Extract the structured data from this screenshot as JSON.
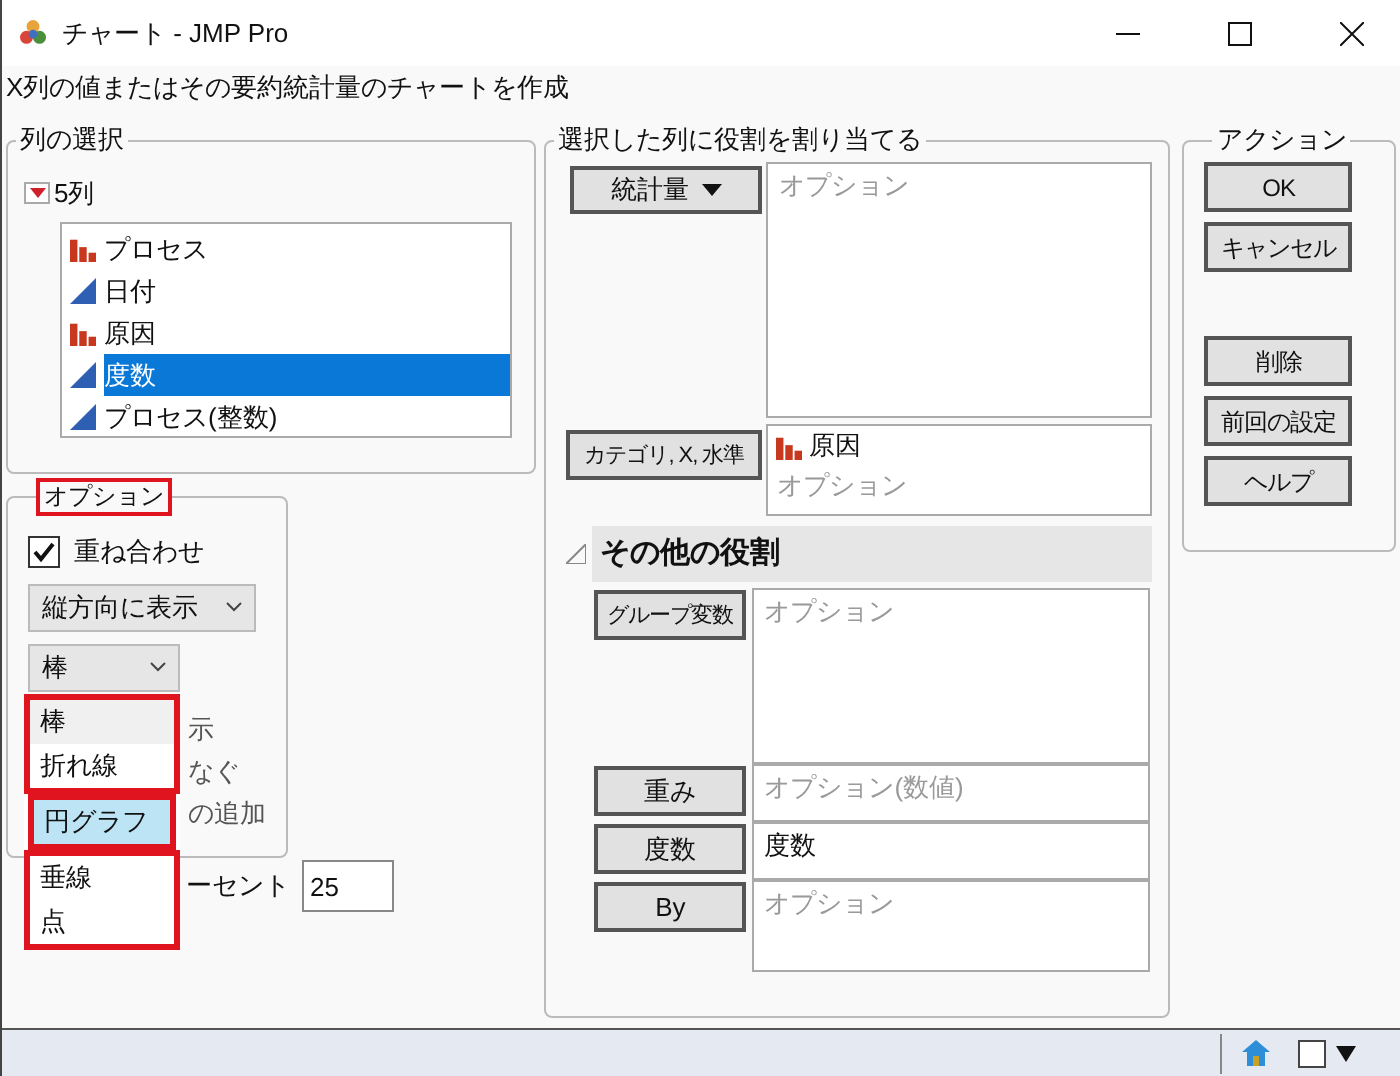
{
  "window": {
    "title": "チャート - JMP Pro"
  },
  "description": "X列の値またはその要約統計量のチャートを作成",
  "column_selection": {
    "title": "列の選択",
    "count_label": "5列",
    "expanded": true,
    "columns": [
      {
        "name": "プロセス",
        "kind": "nominal",
        "selected": false
      },
      {
        "name": "日付",
        "kind": "continuous",
        "selected": false
      },
      {
        "name": "原因",
        "kind": "nominal",
        "selected": false
      },
      {
        "name": "度数",
        "kind": "continuous",
        "selected": true
      },
      {
        "name": "プロセス(整数)",
        "kind": "continuous",
        "selected": false
      }
    ]
  },
  "options": {
    "title": "オプション",
    "title_highlighted": true,
    "overlay": {
      "label": "重ね合わせ",
      "checked": true
    },
    "orientation": "縦方向に表示",
    "chart_type": "棒",
    "covered_rows": [
      "示",
      "なぐ",
      "の追加"
    ],
    "percent": {
      "label": "ーセント",
      "value": "25"
    },
    "dropdown_groups": [
      [
        {
          "label": "棒",
          "hovered": true,
          "selected": false
        },
        {
          "label": "折れ線",
          "hovered": false,
          "selected": false
        }
      ],
      [
        {
          "label": "円グラフ",
          "hovered": false,
          "selected": true
        }
      ],
      [
        {
          "label": "垂線",
          "hovered": false,
          "selected": false
        },
        {
          "label": "点",
          "hovered": false,
          "selected": false
        }
      ]
    ]
  },
  "roles": {
    "title": "選択した列に役割を割り当てる",
    "statistic": {
      "button": "統計量",
      "placeholder": "オプション"
    },
    "category": {
      "button": "カテゴリ, X, 水準",
      "columns": [
        {
          "name": "原因",
          "kind": "nominal"
        }
      ],
      "placeholder": "オプション"
    },
    "other": {
      "title": "その他の役割",
      "expanded": true,
      "roles": [
        {
          "button": "グループ変数",
          "placeholder": "オプション"
        },
        {
          "button": "重み",
          "placeholder": "オプション(数値)"
        },
        {
          "button": "度数",
          "value": "度数"
        },
        {
          "button": "By",
          "placeholder": "オプション"
        }
      ]
    }
  },
  "actions": {
    "title": "アクション",
    "groups": [
      [
        "OK",
        "キャンセル"
      ],
      [
        "削除",
        "前回の設定",
        "ヘルプ"
      ]
    ]
  }
}
